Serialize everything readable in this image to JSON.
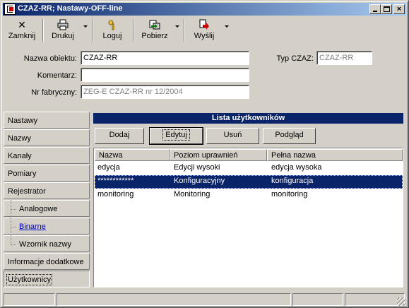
{
  "window": {
    "title": "CZAZ-RR; Nastawy-OFF-line",
    "controls": {
      "minimize": "_",
      "maximize": "□",
      "close": "×"
    }
  },
  "toolbar": {
    "items": [
      {
        "label": "Zamknij",
        "icon": "close-x-icon",
        "glyph": "✕"
      },
      {
        "label": "Drukuj",
        "icon": "printer-icon",
        "glyph": "🖶"
      },
      {
        "label": "Loguj",
        "icon": "key-icon",
        "glyph": "⚿"
      },
      {
        "label": "Pobierz",
        "icon": "download-icon",
        "glyph": "⇩"
      },
      {
        "label": "Wyślij",
        "icon": "send-icon",
        "glyph": "⇨"
      }
    ]
  },
  "form": {
    "object_name_label": "Nazwa obiektu:",
    "object_name_value": "CZAZ-RR",
    "comment_label": "Komentarz:",
    "comment_value": "",
    "serial_label": "Nr fabryczny:",
    "serial_value": "ZEG-E CZAZ-RR nr 12/2004",
    "type_label": "Typ CZAZ:",
    "type_value": "CZAZ-RR"
  },
  "nav": {
    "items": [
      {
        "label": "Nastawy"
      },
      {
        "label": "Nazwy"
      },
      {
        "label": "Kanały"
      },
      {
        "label": "Pomiary"
      },
      {
        "label": "Rejestrator"
      },
      {
        "label": "Analogowe"
      },
      {
        "label": "Binarne"
      },
      {
        "label": "Wzornik nazwy"
      },
      {
        "label": "Informacje dodatkowe"
      },
      {
        "label": "Użytkownicy"
      }
    ]
  },
  "users": {
    "header": "Lista użytkowników",
    "buttons": {
      "add": "Dodaj",
      "edit": "Edytuj",
      "delete": "Usuń",
      "preview": "Podgląd"
    },
    "columns": [
      "Nazwa",
      "Poziom uprawnień",
      "Pełna nazwa"
    ],
    "rows": [
      [
        "edycja",
        "Edycji wysoki",
        "edycja wysoka"
      ],
      [
        "************",
        "Konfiguracyjny",
        "konfiguracja"
      ],
      [
        "monitoring",
        "Monitoring",
        "monitoring"
      ]
    ],
    "selected_row": 1
  },
  "colors": {
    "titlebar_start": "#0a246a",
    "titlebar_end": "#a6caf0",
    "selection": "#0a246a",
    "face": "#d4d0c8"
  }
}
